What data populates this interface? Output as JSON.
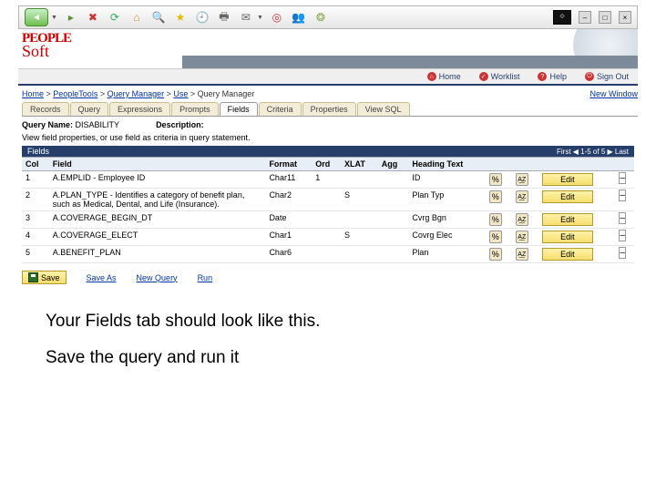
{
  "browser": {
    "icons": [
      "back",
      "stop",
      "home",
      "refresh",
      "favorites",
      "search",
      "history",
      "clock",
      "print",
      "mail",
      "target",
      "people",
      "puzzle"
    ]
  },
  "nav": {
    "home": "Home",
    "worklist": "Worklist",
    "help": "Help",
    "signout": "Sign Out"
  },
  "newWindow": "New Window",
  "breadcrumbs": [
    "Home",
    "PeopleTools",
    "Query Manager",
    "Use",
    "Query Manager"
  ],
  "tabs": [
    "Records",
    "Query",
    "Expressions",
    "Prompts",
    "Fields",
    "Criteria",
    "Properties",
    "View SQL"
  ],
  "activeTab": "Fields",
  "query": {
    "nameLabel": "Query Name:",
    "name": "DISABILITY",
    "descLabel": "Description:",
    "desc": ""
  },
  "hint": "View field properties, or use field as criteria in query statement.",
  "fieldsBar": {
    "title": "Fields",
    "pager": "First  ◀ 1-5 of 5 ▶  Last"
  },
  "columns": [
    "Col",
    "Field",
    "Format",
    "Ord",
    "XLAT",
    "Agg",
    "Heading Text",
    "",
    "",
    "",
    ""
  ],
  "rows": [
    {
      "col": "1",
      "field": "A.EMPLID - Employee ID",
      "format": "Char11",
      "ord": "1",
      "xlat": "",
      "agg": "",
      "heading": "ID"
    },
    {
      "col": "2",
      "field": "A.PLAN_TYPE - Identifies a category of benefit plan, such as Medical, Dental, and Life (Insurance).",
      "format": "Char2",
      "ord": "",
      "xlat": "S",
      "agg": "",
      "heading": "Plan Typ"
    },
    {
      "col": "3",
      "field": "A.COVERAGE_BEGIN_DT",
      "format": "Date",
      "ord": "",
      "xlat": "",
      "agg": "",
      "heading": "Cvrg Bgn"
    },
    {
      "col": "4",
      "field": "A.COVERAGE_ELECT",
      "format": "Char1",
      "ord": "",
      "xlat": "S",
      "agg": "",
      "heading": "Covrg Elec"
    },
    {
      "col": "5",
      "field": "A.BENEFIT_PLAN",
      "format": "Char6",
      "ord": "",
      "xlat": "",
      "agg": "",
      "heading": "Plan"
    }
  ],
  "editLabel": "Edit",
  "save": {
    "save": "Save",
    "saveAs": "Save As",
    "newQuery": "New Query",
    "run": "Run"
  },
  "caption1": "Your Fields tab should look like this.",
  "caption2": "Save the query and run it"
}
